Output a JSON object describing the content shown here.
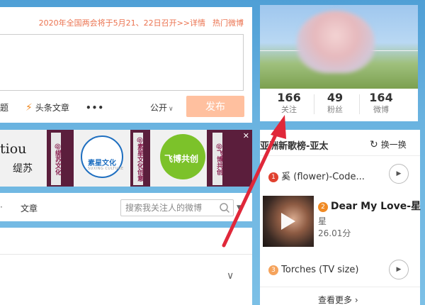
{
  "composer": {
    "notice": "2020年全国两会将于5月21、22日召开>>详情",
    "hot_link": "热门微博",
    "tools": {
      "topic": "题",
      "article": "头条文章",
      "more": "•••"
    },
    "visibility": "公开",
    "publish": "发布"
  },
  "banner": {
    "close": "✕",
    "tiles": [
      {
        "logo": "tiou",
        "logo_cn": "缇苏",
        "strip": "@缇苏文化"
      },
      {
        "logo": "素星文化",
        "logo_sub": "SUXING CULTURE",
        "strip": "@素星文化创意"
      },
      {
        "logo": "飞博共创",
        "strip": "@飞博共创"
      }
    ]
  },
  "tabs": {
    "ellipsis": "·",
    "article": "文章",
    "search_placeholder": "搜索我关注人的微博"
  },
  "profile": {
    "stats": [
      {
        "num": "166",
        "label": "关注"
      },
      {
        "num": "49",
        "label": "粉丝"
      },
      {
        "num": "164",
        "label": "微博"
      }
    ]
  },
  "music": {
    "title": "亚洲新歌榜-亚太",
    "refresh": "换一换",
    "songs": [
      {
        "rank": "1",
        "title": "奚 (flower)-Code..."
      },
      {
        "rank": "2",
        "title": "Dear My Love-星",
        "artist": "星",
        "score": "26.01分"
      },
      {
        "rank": "3",
        "title": "Torches (TV size)"
      }
    ],
    "see_more": "查看更多 ›"
  },
  "colors": {
    "background": "#5aa6da",
    "accent_orange": "#eb7350",
    "publish_disabled": "#ffc09f",
    "arrow": "#e0283a"
  }
}
